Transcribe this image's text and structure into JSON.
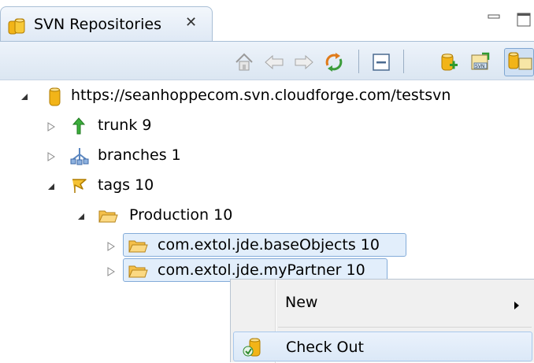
{
  "view": {
    "tab_title": "SVN Repositories",
    "tab_close": "✕"
  },
  "toolbar": {
    "buttons": [
      "home-icon",
      "back-icon",
      "forward-icon",
      "refresh-icon",
      "collapse-all-icon",
      "new-repository-icon",
      "import-svn-icon",
      "link-with-editor-icon"
    ]
  },
  "tree": {
    "root": {
      "label": "https://seanhoppecom.svn.cloudforge.com/testsvn",
      "expanded": true
    },
    "trunk": {
      "label": "trunk 9",
      "expanded": false
    },
    "branches": {
      "label": "branches 1",
      "expanded": false
    },
    "tags": {
      "label": "tags 10",
      "expanded": true
    },
    "production": {
      "label": "Production 10",
      "expanded": true
    },
    "base_objects": {
      "label": "com.extol.jde.baseObjects 10",
      "expanded": false,
      "selected": true
    },
    "my_partner": {
      "label": "com.extol.jde.myPartner 10",
      "expanded": false,
      "selected": true
    }
  },
  "context_menu": {
    "new_label": "New",
    "check_out_label": "Check Out"
  },
  "colors": {
    "selection_fill": "#e2eefb",
    "selection_border": "#84acd9",
    "repository_icon": "#f2b418",
    "folder_icon": "#f5c04a"
  }
}
